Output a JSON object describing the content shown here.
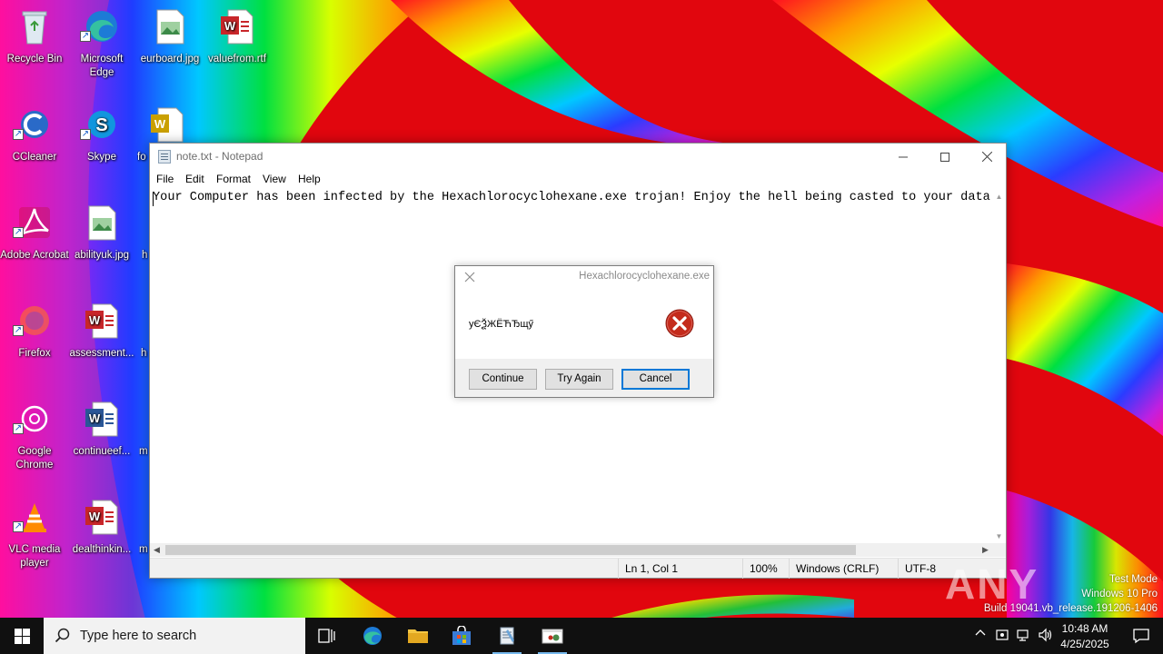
{
  "desktop": {
    "icons": [
      {
        "name": "recycle-bin",
        "label": "Recycle Bin"
      },
      {
        "name": "microsoft-edge",
        "label": "Microsoft Edge"
      },
      {
        "name": "eurboard-jpg",
        "label": "eurboard.jpg"
      },
      {
        "name": "valuefrom-rtf",
        "label": "valuefrom.rtf"
      },
      {
        "name": "ccleaner",
        "label": "CCleaner"
      },
      {
        "name": "skype",
        "label": "Skype"
      },
      {
        "name": "fo-doc",
        "label": "fo"
      },
      {
        "name": "adobe-acrobat",
        "label": "Adobe Acrobat"
      },
      {
        "name": "abilityuk-jpg",
        "label": "abilityuk.jpg"
      },
      {
        "name": "h-doc-1",
        "label": "h"
      },
      {
        "name": "firefox",
        "label": "Firefox"
      },
      {
        "name": "assessment-doc",
        "label": "assessment..."
      },
      {
        "name": "h-doc-2",
        "label": "h"
      },
      {
        "name": "google-chrome",
        "label": "Google Chrome"
      },
      {
        "name": "continueef-doc",
        "label": "continueef..."
      },
      {
        "name": "m-doc-1",
        "label": "m"
      },
      {
        "name": "vlc-media-player",
        "label": "VLC media player"
      },
      {
        "name": "dealthinkin-doc",
        "label": "dealthinkin..."
      },
      {
        "name": "m-doc-2",
        "label": "m"
      }
    ]
  },
  "notepad": {
    "title": "note.txt - Notepad",
    "menu": [
      "File",
      "Edit",
      "Format",
      "View",
      "Help"
    ],
    "content": "Your Computer has been infected by the Hexachlorocyclohexane.exe trojan! Enjoy the hell being casted to your data a",
    "status": {
      "position": "Ln 1, Col 1",
      "zoom": "100%",
      "line_ending": "Windows (CRLF)",
      "encoding": "UTF-8"
    }
  },
  "msgbox": {
    "title": "Hexachlorocyclohexane.exe",
    "message": "уЄѮЖЁЋЂщӳ",
    "buttons": {
      "continue": "Continue",
      "try_again": "Try Again",
      "cancel": "Cancel"
    }
  },
  "watermark": {
    "brand": "ANY RUN",
    "line1": "Test Mode",
    "line2": "Windows 10 Pro",
    "line3": "Build 19041.vb_release.191206-1406"
  },
  "taskbar": {
    "search_placeholder": "Type here to search",
    "time": "10:48 AM",
    "date": "4/25/2025"
  },
  "colors": {
    "wallpaper_base": "#e1060e",
    "taskbar": "#101010",
    "accent": "#0078d7",
    "error_icon": "#c42b1c"
  }
}
